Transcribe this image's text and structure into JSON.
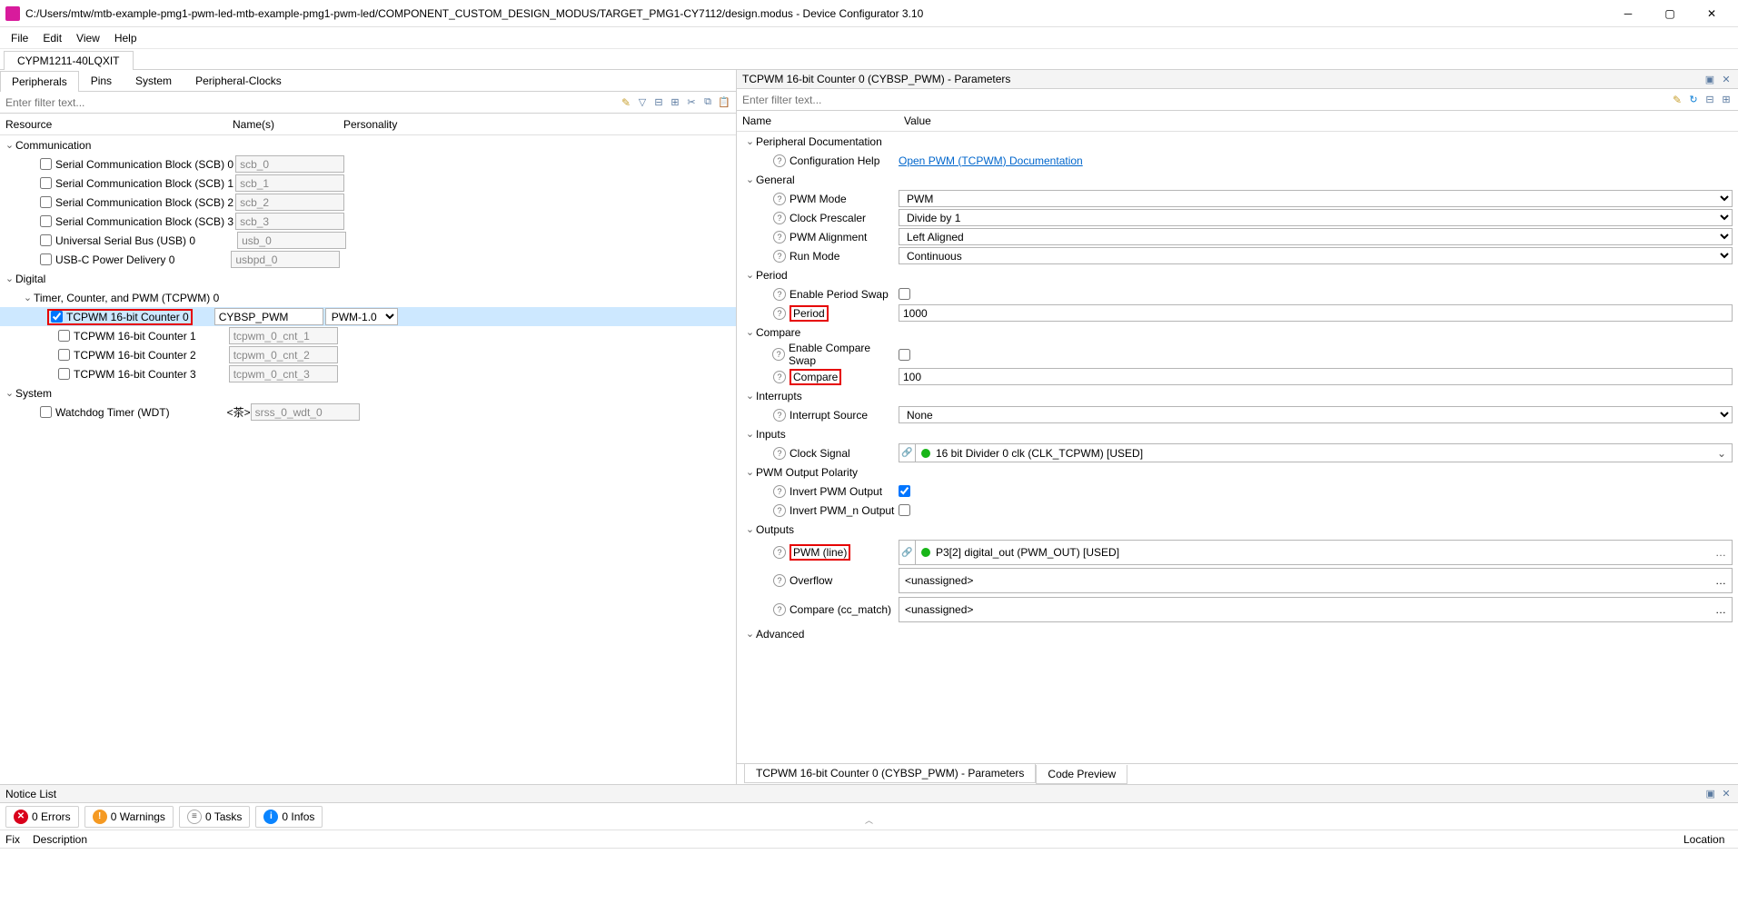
{
  "window": {
    "title": "C:/Users/mtw/mtb-example-pmg1-pwm-led-mtb-example-pmg1-pwm-led/COMPONENT_CUSTOM_DESIGN_MODUS/TARGET_PMG1-CY7112/design.modus - Device Configurator 3.10"
  },
  "menu": {
    "file": "File",
    "edit": "Edit",
    "view": "View",
    "help": "Help"
  },
  "deviceTab": "CYPM1211-40LQXIT",
  "leftTabs": {
    "peripherals": "Peripherals",
    "pins": "Pins",
    "system": "System",
    "clocks": "Peripheral-Clocks"
  },
  "filterPlaceholder": "Enter filter text...",
  "leftHeaders": {
    "resource": "Resource",
    "names": "Name(s)",
    "personality": "Personality"
  },
  "tree": {
    "communication": "Communication",
    "scb0": {
      "label": "Serial Communication Block (SCB) 0",
      "name": "scb_0"
    },
    "scb1": {
      "label": "Serial Communication Block (SCB) 1",
      "name": "scb_1"
    },
    "scb2": {
      "label": "Serial Communication Block (SCB) 2",
      "name": "scb_2"
    },
    "scb3": {
      "label": "Serial Communication Block (SCB) 3",
      "name": "scb_3"
    },
    "usb0": {
      "label": "Universal Serial Bus (USB) 0",
      "name": "usb_0"
    },
    "usbpd0": {
      "label": "USB-C Power Delivery 0",
      "name": "usbpd_0"
    },
    "digital": "Digital",
    "tcpwm0": "Timer, Counter, and PWM (TCPWM) 0",
    "cnt0": {
      "label": "TCPWM 16-bit Counter 0",
      "name": "CYBSP_PWM",
      "personality": "PWM-1.0"
    },
    "cnt1": {
      "label": "TCPWM 16-bit Counter 1",
      "name": "tcpwm_0_cnt_1"
    },
    "cnt2": {
      "label": "TCPWM 16-bit Counter 2",
      "name": "tcpwm_0_cnt_2"
    },
    "cnt3": {
      "label": "TCPWM 16-bit Counter 3",
      "name": "tcpwm_0_cnt_3"
    },
    "system": "System",
    "wdt": {
      "label": "Watchdog Timer (WDT)",
      "name": "srss_0_wdt_0"
    }
  },
  "rightTitle": "TCPWM 16-bit Counter 0 (CYBSP_PWM) - Parameters",
  "paramHeaders": {
    "name": "Name",
    "value": "Value"
  },
  "params": {
    "docGroup": "Peripheral Documentation",
    "configHelp": {
      "label": "Configuration Help",
      "value": "Open PWM (TCPWM) Documentation"
    },
    "generalGroup": "General",
    "pwmMode": {
      "label": "PWM Mode",
      "value": "PWM"
    },
    "prescaler": {
      "label": "Clock Prescaler",
      "value": "Divide by 1"
    },
    "alignment": {
      "label": "PWM Alignment",
      "value": "Left Aligned"
    },
    "runMode": {
      "label": "Run Mode",
      "value": "Continuous"
    },
    "periodGroup": "Period",
    "periodSwap": {
      "label": "Enable Period Swap"
    },
    "period": {
      "label": "Period",
      "value": "1000"
    },
    "compareGroup": "Compare",
    "compareSwap": {
      "label": "Enable Compare Swap"
    },
    "compare": {
      "label": "Compare",
      "value": "100"
    },
    "interruptsGroup": "Interrupts",
    "interruptSource": {
      "label": "Interrupt Source",
      "value": "None"
    },
    "inputsGroup": "Inputs",
    "clockSignal": {
      "label": "Clock Signal",
      "value": "16 bit Divider 0 clk (CLK_TCPWM) [USED]"
    },
    "polarityGroup": "PWM Output Polarity",
    "invertPwm": {
      "label": "Invert PWM Output"
    },
    "invertPwmN": {
      "label": "Invert PWM_n Output"
    },
    "outputsGroup": "Outputs",
    "pwmLine": {
      "label": "PWM (line)",
      "value": "P3[2] digital_out (PWM_OUT) [USED]"
    },
    "overflow": {
      "label": "Overflow",
      "value": "<unassigned>"
    },
    "ccMatch": {
      "label": "Compare (cc_match)",
      "value": "<unassigned>"
    },
    "advancedGroup": "Advanced"
  },
  "rightBottomTabs": {
    "params": "TCPWM 16-bit Counter 0 (CYBSP_PWM) - Parameters",
    "codePreview": "Code Preview"
  },
  "notice": {
    "title": "Notice List",
    "errors": "0 Errors",
    "warnings": "0 Warnings",
    "tasks": "0 Tasks",
    "infos": "0 Infos",
    "fix": "Fix",
    "description": "Description",
    "location": "Location"
  }
}
